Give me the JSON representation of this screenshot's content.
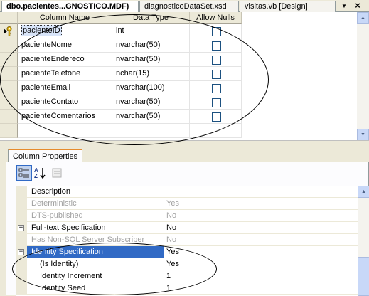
{
  "tabs": [
    {
      "label": "dbo.pacientes...GNOSTICO.MDF)",
      "active": true
    },
    {
      "label": "diagnosticoDataSet.xsd",
      "active": false
    },
    {
      "label": "visitas.vb [Design]",
      "active": false
    }
  ],
  "tab_dropdown_icon": "chevron-down-icon",
  "tab_close_glyph": "×",
  "grid": {
    "headers": [
      "Column Name",
      "Data Type",
      "Allow Nulls"
    ],
    "rows": [
      {
        "name": "pacienteID",
        "type": "int",
        "allow_nulls": false,
        "primary_key": true
      },
      {
        "name": "pacienteNome",
        "type": "nvarchar(50)",
        "allow_nulls": false
      },
      {
        "name": "pacienteEndereco",
        "type": "nvarchar(50)",
        "allow_nulls": false
      },
      {
        "name": "pacienteTelefone",
        "type": "nchar(15)",
        "allow_nulls": false
      },
      {
        "name": "pacienteEmail",
        "type": "nvarchar(100)",
        "allow_nulls": false
      },
      {
        "name": "pacienteContato",
        "type": "nvarchar(50)",
        "allow_nulls": false
      },
      {
        "name": "pacienteComentarios",
        "type": "nvarchar(50)",
        "allow_nulls": false
      },
      {
        "name": "",
        "type": "",
        "allow_nulls": false
      }
    ]
  },
  "column_properties": {
    "tab_label": "Column Properties",
    "properties": [
      {
        "name": "Description",
        "value": "",
        "state": "normal"
      },
      {
        "name": "Deterministic",
        "value": "Yes",
        "state": "disabled"
      },
      {
        "name": "DTS-published",
        "value": "No",
        "state": "disabled"
      },
      {
        "name": "Full-text Specification",
        "value": "No",
        "state": "normal",
        "expander": "+"
      },
      {
        "name": "Has Non-SQL Server Subscriber",
        "value": "No",
        "state": "disabled"
      },
      {
        "name": "Identity Specification",
        "value": "Yes",
        "state": "selected",
        "expander": "−"
      },
      {
        "name": "(Is Identity)",
        "value": "Yes",
        "state": "child"
      },
      {
        "name": "Identity Increment",
        "value": "1",
        "state": "child"
      },
      {
        "name": "Identity Seed",
        "value": "1",
        "state": "child"
      }
    ]
  },
  "colors": {
    "selection": "#316ac5",
    "chrome": "#ece9d8",
    "scroll_button": "#c8d8f8",
    "tab_highlight": "#e68b2c"
  }
}
